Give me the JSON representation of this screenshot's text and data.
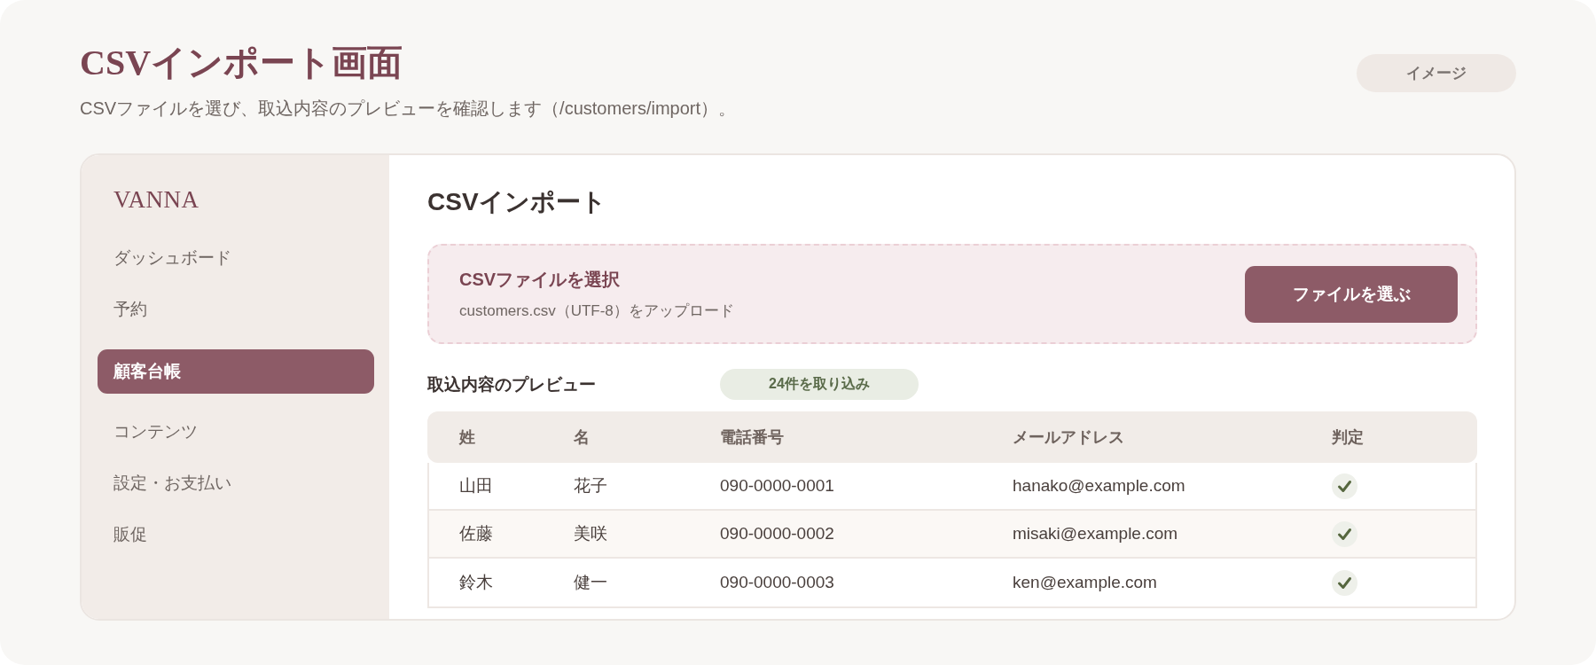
{
  "header": {
    "title": "CSVインポート画面",
    "subtitle": "CSVファイルを選び、取込内容のプレビューを確認します（/customers/import）。",
    "badge": "イメージ"
  },
  "sidebar": {
    "brand": "VANNA",
    "items": [
      {
        "label": "ダッシュボード",
        "selected": false
      },
      {
        "label": "予約",
        "selected": false
      },
      {
        "label": "顧客台帳",
        "selected": true
      },
      {
        "label": "コンテンツ",
        "selected": false
      },
      {
        "label": "設定・お支払い",
        "selected": false
      },
      {
        "label": "販促",
        "selected": false
      }
    ]
  },
  "main": {
    "title": "CSVインポート",
    "upload": {
      "title": "CSVファイルを選択",
      "hint": "customers.csv（UTF-8）をアップロード",
      "button": "ファイルを選ぶ"
    },
    "preview": {
      "title": "取込内容のプレビュー",
      "count_badge": "24件を取り込み"
    },
    "table": {
      "columns": [
        "姓",
        "名",
        "電話番号",
        "メールアドレス",
        "判定"
      ],
      "rows": [
        {
          "cells": [
            "山田",
            "花子",
            "090-0000-0001",
            "hanako@example.com"
          ],
          "valid": true
        },
        {
          "cells": [
            "佐藤",
            "美咲",
            "090-0000-0002",
            "misaki@example.com"
          ],
          "valid": true
        },
        {
          "cells": [
            "鈴木",
            "健一",
            "090-0000-0003",
            "ken@example.com"
          ],
          "valid": true
        }
      ]
    }
  }
}
